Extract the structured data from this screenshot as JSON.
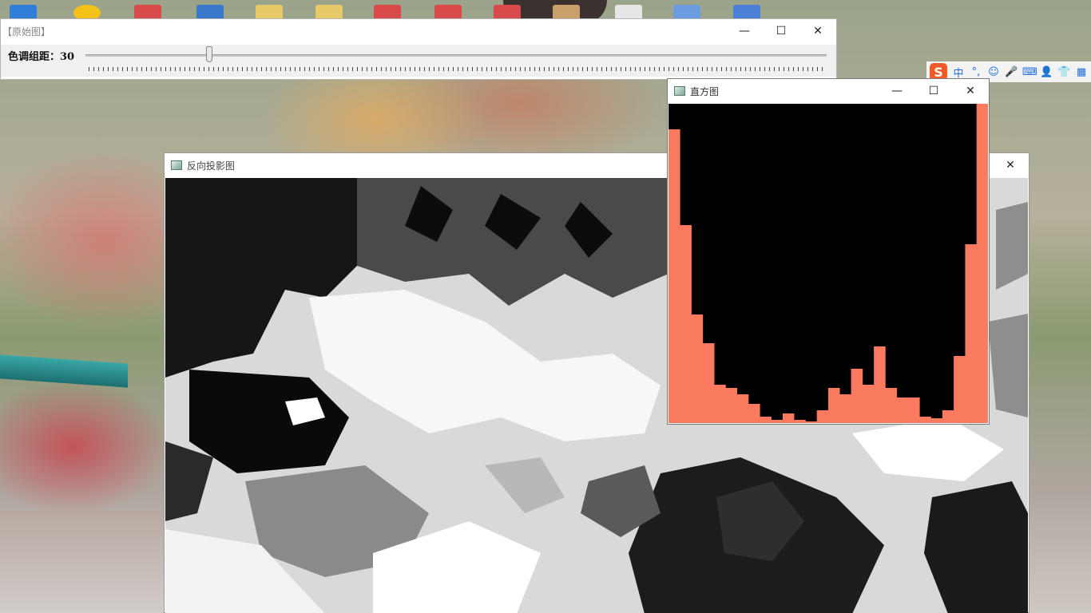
{
  "windows": {
    "original": {
      "title": "【原始图】",
      "trackbar": {
        "label": "色调组距：30",
        "value": 30
      }
    },
    "back_projection": {
      "title": "反向投影图"
    },
    "histogram": {
      "title": "直方图"
    }
  },
  "controls": {
    "minimize": "—",
    "maximize": "☐",
    "close": "✕"
  },
  "ime": {
    "logo": "S",
    "items": [
      "中",
      "°,",
      "☺",
      "🎤",
      "⌨",
      "👤",
      "👕",
      "▦"
    ]
  },
  "histogram_bars": [
    92,
    62,
    34,
    25,
    12,
    11,
    9,
    6,
    2,
    1,
    3,
    1,
    0.5,
    4,
    11,
    9,
    17,
    12,
    24,
    11,
    8,
    8,
    2,
    1.5,
    4,
    21,
    56,
    100
  ],
  "colors": {
    "bar": "#fa7a60",
    "background": "#000000"
  }
}
